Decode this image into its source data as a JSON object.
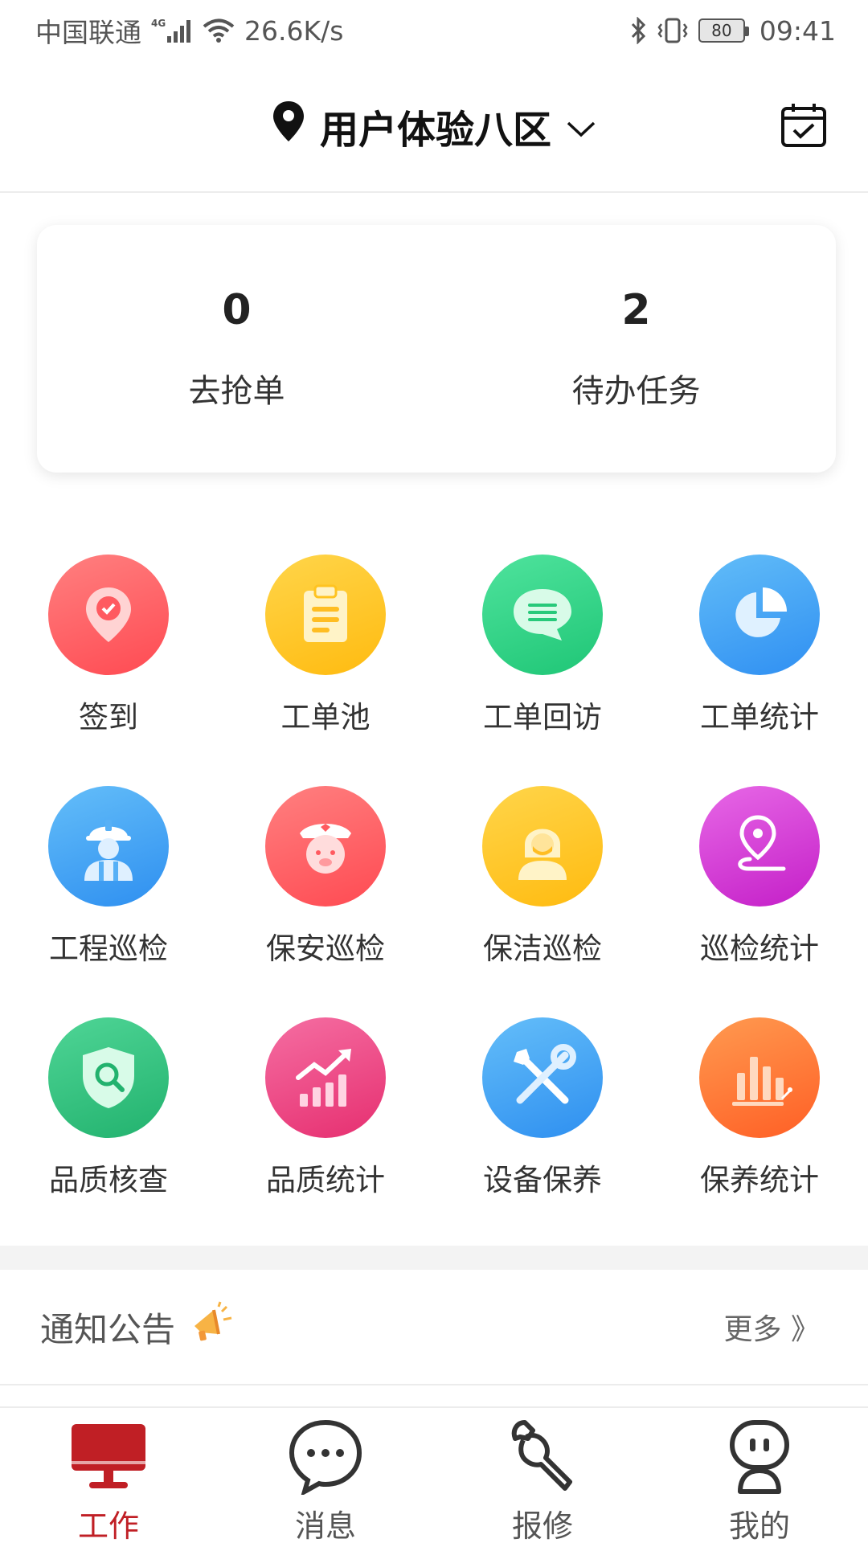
{
  "status_bar": {
    "carrier": "中国联通",
    "network_type": "4G",
    "speed": "26.6K/s",
    "battery": "80",
    "time": "09:41"
  },
  "header": {
    "location": "用户体验八区"
  },
  "summary": [
    {
      "value": "0",
      "label": "去抢单"
    },
    {
      "value": "2",
      "label": "待办任务"
    }
  ],
  "grid": [
    {
      "label": "签到",
      "icon": "location-check-icon",
      "color": "#ff5f63"
    },
    {
      "label": "工单池",
      "icon": "clipboard-icon",
      "color": "#ffc92a"
    },
    {
      "label": "工单回访",
      "icon": "chat-bubble-icon",
      "color": "#2fd183"
    },
    {
      "label": "工单统计",
      "icon": "pie-chart-icon",
      "color": "#3fa3f5"
    },
    {
      "label": "工程巡检",
      "icon": "engineer-icon",
      "color": "#4ba6f6"
    },
    {
      "label": "保安巡检",
      "icon": "security-guard-icon",
      "color": "#ff5c62"
    },
    {
      "label": "保洁巡检",
      "icon": "cleaner-icon",
      "color": "#ffc620"
    },
    {
      "label": "巡检统计",
      "icon": "route-pin-icon",
      "color": "#d33ad6"
    },
    {
      "label": "品质核查",
      "icon": "shield-search-icon",
      "color": "#33c281"
    },
    {
      "label": "品质统计",
      "icon": "trend-chart-icon",
      "color": "#ef4d86"
    },
    {
      "label": "设备保养",
      "icon": "tools-icon",
      "color": "#47a6f4"
    },
    {
      "label": "保养统计",
      "icon": "bar-chart-icon",
      "color": "#ff7a3c"
    }
  ],
  "notice": {
    "title": "通知公告",
    "more": "更多 》"
  },
  "bottom_nav": [
    {
      "label": "工作",
      "icon": "monitor-icon",
      "active": true
    },
    {
      "label": "消息",
      "icon": "message-icon",
      "active": false
    },
    {
      "label": "报修",
      "icon": "wrench-icon",
      "active": false
    },
    {
      "label": "我的",
      "icon": "profile-icon",
      "active": false
    }
  ],
  "colors": {
    "accent": "#c01f25"
  }
}
